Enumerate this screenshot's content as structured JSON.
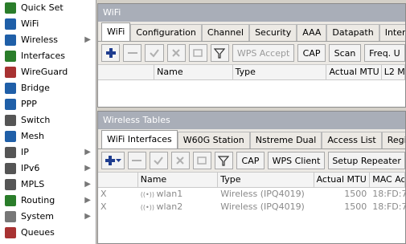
{
  "sidebar": {
    "items": [
      {
        "label": "Quick Set",
        "icon": "quick-set-icon",
        "arrow": false
      },
      {
        "label": "WiFi",
        "icon": "wifi-icon",
        "arrow": false
      },
      {
        "label": "Wireless",
        "icon": "wireless-icon",
        "arrow": true
      },
      {
        "label": "Interfaces",
        "icon": "interfaces-icon",
        "arrow": false
      },
      {
        "label": "WireGuard",
        "icon": "wireguard-icon",
        "arrow": false
      },
      {
        "label": "Bridge",
        "icon": "bridge-icon",
        "arrow": false
      },
      {
        "label": "PPP",
        "icon": "ppp-icon",
        "arrow": false
      },
      {
        "label": "Switch",
        "icon": "switch-icon",
        "arrow": false
      },
      {
        "label": "Mesh",
        "icon": "mesh-icon",
        "arrow": false
      },
      {
        "label": "IP",
        "icon": "ip-icon",
        "arrow": true
      },
      {
        "label": "IPv6",
        "icon": "ipv6-icon",
        "arrow": true
      },
      {
        "label": "MPLS",
        "icon": "mpls-icon",
        "arrow": true
      },
      {
        "label": "Routing",
        "icon": "routing-icon",
        "arrow": true
      },
      {
        "label": "System",
        "icon": "system-icon",
        "arrow": true
      },
      {
        "label": "Queues",
        "icon": "queues-icon",
        "arrow": false
      }
    ],
    "arrow_glyph": "▶"
  },
  "wifi_window": {
    "title": "WiFi",
    "tabs": [
      "WiFi",
      "Configuration",
      "Channel",
      "Security",
      "AAA",
      "Datapath",
      "Interworking"
    ],
    "active_tab": 0,
    "buttons": {
      "wps_accept": "WPS Accept",
      "cap": "CAP",
      "scan": "Scan",
      "freq": "Freq. U"
    },
    "columns": [
      "Name",
      "Type",
      "Actual MTU",
      "L2 M"
    ]
  },
  "wireless_window": {
    "title": "Wireless Tables",
    "tabs": [
      "WiFi Interfaces",
      "W60G Station",
      "Nstreme Dual",
      "Access List",
      "Registration"
    ],
    "active_tab": 0,
    "buttons": {
      "cap": "CAP",
      "wps_client": "WPS Client",
      "setup_repeater": "Setup Repeater"
    },
    "columns": [
      "Name",
      "Type",
      "Actual MTU",
      "MAC Ad"
    ],
    "rows": [
      {
        "flag": "X",
        "name": "wlan1",
        "type": "Wireless (IPQ4019)",
        "mtu": "1500",
        "mac": "18:FD:7"
      },
      {
        "flag": "X",
        "name": "wlan2",
        "type": "Wireless (IPQ4019)",
        "mtu": "1500",
        "mac": "18:FD:7"
      }
    ]
  },
  "colors": {
    "titlebar": "#a9aeb8",
    "sidebar_bg": "#ffffff",
    "window_bg": "#ece9e4",
    "add_icon": "#1f3d8f",
    "disabled_text": "#8a8a8a"
  }
}
